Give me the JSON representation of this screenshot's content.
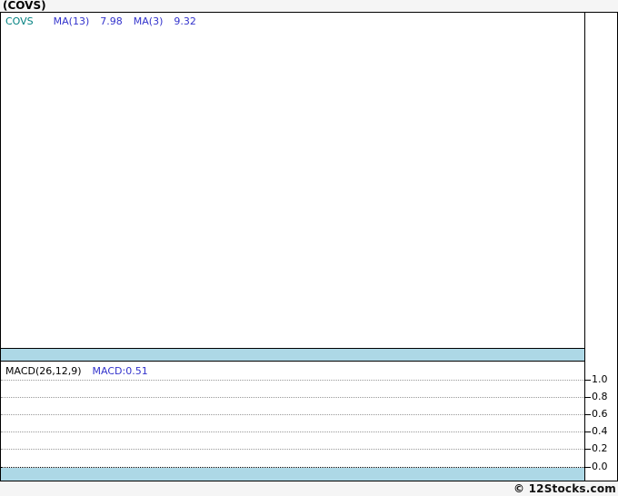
{
  "header": {
    "title": "(COVS)"
  },
  "colors": {
    "band_blue": "#add8e6",
    "ticker_teal": "#008080",
    "indicator_blue": "#3333cc",
    "background_gray": "#f5f5f5",
    "gridline_gray": "#999999"
  },
  "price_panel": {
    "legend": {
      "symbol": "COVS",
      "ma13_label": "MA(13)",
      "ma13_value": "7.98",
      "ma3_label": "MA(3)",
      "ma3_value": "9.32"
    }
  },
  "macd_panel": {
    "legend": {
      "params_label": "MACD(26,12,9)",
      "value_label": "MACD:0.51"
    },
    "yticks": [
      {
        "label": "1.0",
        "value": 1.0
      },
      {
        "label": "0.8",
        "value": 0.8
      },
      {
        "label": "0.6",
        "value": 0.6
      },
      {
        "label": "0.4",
        "value": 0.4
      },
      {
        "label": "0.2",
        "value": 0.2
      },
      {
        "label": "0.0",
        "value": 0.0
      }
    ]
  },
  "footer": {
    "credit": "© 12Stocks.com"
  },
  "chart_data": [
    {
      "type": "line",
      "title": "(COVS) price panel",
      "series": [
        {
          "name": "COVS",
          "values": []
        },
        {
          "name": "MA(13)",
          "last_value": 7.98
        },
        {
          "name": "MA(3)",
          "last_value": 9.32
        }
      ],
      "note": "plot area is empty - no price data points are rendered in the screenshot",
      "grid": "off",
      "legend_position": "top-left"
    },
    {
      "type": "line",
      "title": "MACD(26,12,9)",
      "series": [
        {
          "name": "MACD",
          "last_value": 0.51,
          "values": []
        }
      ],
      "ylabel": "",
      "ylim": [
        0.0,
        1.0
      ],
      "yticks": [
        1.0,
        0.8,
        0.6,
        0.4,
        0.2,
        0.0
      ],
      "yaxis_position": "right",
      "grid": "dotted horizontal",
      "note": "no MACD line/histogram visible, only gridlines and legend value",
      "legend_position": "top-left"
    }
  ]
}
